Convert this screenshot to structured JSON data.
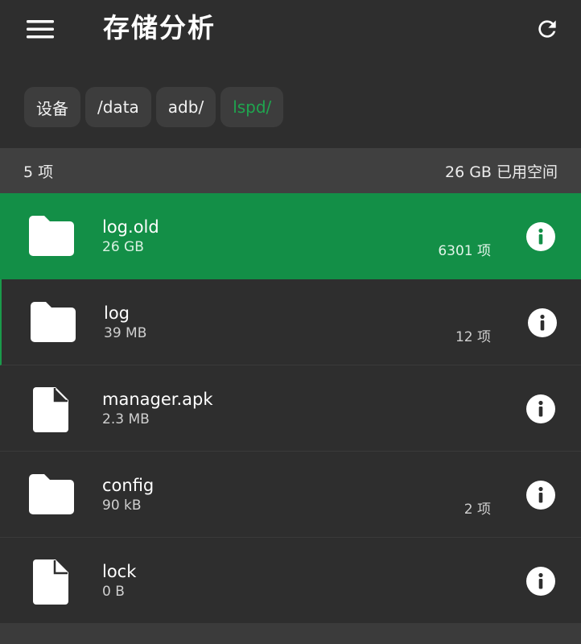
{
  "header": {
    "title": "存储分析",
    "menu_icon": "hamburger-menu-icon",
    "refresh_icon": "refresh-icon"
  },
  "breadcrumb": [
    {
      "label": "设备",
      "active": false
    },
    {
      "label": "/data",
      "active": false
    },
    {
      "label": "adb/",
      "active": false
    },
    {
      "label": "lspd/",
      "active": true
    }
  ],
  "summary": {
    "count": "5 项",
    "used": "26 GB 已用空间"
  },
  "items": [
    {
      "name": "log.old",
      "size": "26 GB",
      "count": "6301 项",
      "type": "folder",
      "selected": true
    },
    {
      "name": "log",
      "size": "39 MB",
      "count": "12 项",
      "type": "folder",
      "selected": false
    },
    {
      "name": "manager.apk",
      "size": "2.3 MB",
      "count": "",
      "type": "file",
      "selected": false
    },
    {
      "name": "config",
      "size": "90 kB",
      "count": "2 项",
      "type": "folder",
      "selected": false
    },
    {
      "name": "lock",
      "size": "0 B",
      "count": "",
      "type": "file",
      "selected": false
    }
  ],
  "colors": {
    "background": "#2e2e2e",
    "accent": "#1fa64f",
    "selected_row": "#138f47"
  }
}
